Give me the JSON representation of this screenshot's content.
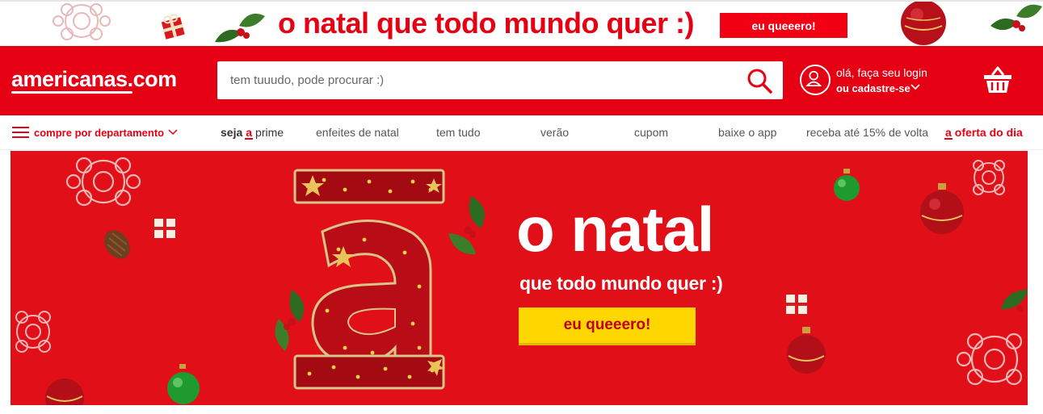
{
  "promo": {
    "text": "o natal que todo mundo quer :)",
    "button_label": "eu queeero!"
  },
  "header": {
    "logo": "americanas.com",
    "search": {
      "placeholder": "tem tuuudo, pode procurar :)",
      "value": ""
    },
    "login": {
      "line1": "olá, faça seu login",
      "line2": "ou cadastre-se"
    }
  },
  "nav": {
    "department_label": "compre por departamento",
    "prime": {
      "seja": "seja",
      "badge": "a",
      "prime": "prime"
    },
    "items": [
      "enfeites de natal",
      "tem tudo",
      "verão",
      "cupom",
      "baixe o app",
      "receba até 15% de volta"
    ],
    "oferta": {
      "badge": "a",
      "label": "oferta do dia"
    }
  },
  "hero": {
    "title": "o natal",
    "subtitle": "que todo mundo quer :)",
    "button_label": "eu queeero!"
  },
  "colors": {
    "brand_red": "#e60014",
    "hero_red": "#e00f18",
    "cta_yellow": "#ffd700"
  },
  "icons": [
    "snowflake-ornament-icon",
    "gift-box-icon",
    "holly-icon",
    "ornament-ball-icon",
    "search-icon",
    "user-icon",
    "chevron-down-icon",
    "basket-icon",
    "hamburger-menu-icon",
    "pine-cone-icon"
  ]
}
